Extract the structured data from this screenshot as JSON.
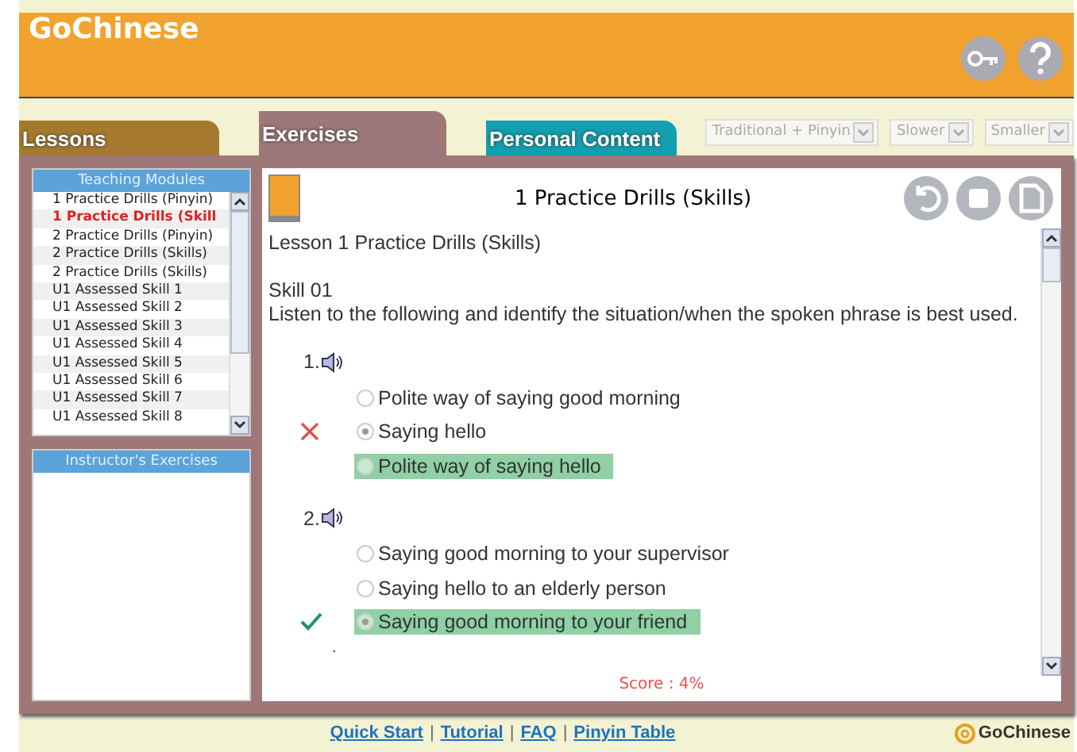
{
  "header": {
    "logo": "GoChinese"
  },
  "tabs": [
    {
      "label": "Lessons",
      "selected": false,
      "color": "#a57a2e"
    },
    {
      "label": "Exercises",
      "selected": true,
      "color": "#9e7878"
    },
    {
      "label": "Personal Content",
      "selected": false,
      "color": "#12a0b0"
    }
  ],
  "dropdowns": [
    {
      "value": "Traditional + Pinyin",
      "disabled": true
    },
    {
      "value": "Slower",
      "disabled": true
    },
    {
      "value": "Smaller",
      "disabled": true
    }
  ],
  "sidebar": {
    "modules_title": "Teaching Modules",
    "modules": [
      {
        "label": "1 Practice Drills (Pinyin)",
        "selected": false
      },
      {
        "label": "1 Practice Drills (Skill",
        "selected": true
      },
      {
        "label": "2 Practice Drills (Pinyin)",
        "selected": false
      },
      {
        "label": "2 Practice Drills (Skills)",
        "selected": false
      },
      {
        "label": "2 Practice Drills (Skills)",
        "selected": false
      },
      {
        "label": "U1 Assessed Skill 1",
        "selected": false
      },
      {
        "label": "U1 Assessed Skill 2",
        "selected": false
      },
      {
        "label": "U1 Assessed Skill 3",
        "selected": false
      },
      {
        "label": "U1 Assessed Skill 4",
        "selected": false
      },
      {
        "label": "U1 Assessed Skill 5",
        "selected": false
      },
      {
        "label": "U1 Assessed Skill 6",
        "selected": false
      },
      {
        "label": "U1 Assessed Skill 7",
        "selected": false
      },
      {
        "label": "U1 Assessed Skill 8",
        "selected": false
      }
    ],
    "instructor_title": "Instructor's Exercises"
  },
  "content": {
    "title": "1 Practice Drills (Skills)",
    "lesson": "Lesson 1 Practice Drills (Skills)",
    "skill": "Skill 01",
    "instruction": "Listen to the following and identify the situation/when the spoken phrase is best used.",
    "questions": [
      {
        "number": "1.",
        "answered_correctly": false,
        "options": [
          {
            "text": "Polite way of saying good morning",
            "selected": false,
            "correct": false
          },
          {
            "text": "Saying hello",
            "selected": true,
            "correct": false
          },
          {
            "text": "Polite way of saying hello",
            "selected": false,
            "correct": true
          }
        ]
      },
      {
        "number": "2.",
        "answered_correctly": true,
        "options": [
          {
            "text": "Saying good morning to your supervisor",
            "selected": false,
            "correct": false
          },
          {
            "text": "Saying hello to an elderly person",
            "selected": false,
            "correct": false
          },
          {
            "text": "Saying good morning to your friend",
            "selected": true,
            "correct": true
          }
        ]
      }
    ],
    "trailing": ".",
    "score": "Score : 4%"
  },
  "footer": {
    "items": [
      {
        "kind": "link",
        "text": "Quick Start"
      },
      {
        "kind": "sep",
        "text": "|"
      },
      {
        "kind": "link",
        "text": "Tutorial"
      },
      {
        "kind": "sep",
        "text": "|"
      },
      {
        "kind": "link",
        "text": "FAQ"
      },
      {
        "kind": "sep",
        "text": "|"
      },
      {
        "kind": "link",
        "text": "Pinyin Table"
      }
    ],
    "brand": "GoChinese"
  }
}
